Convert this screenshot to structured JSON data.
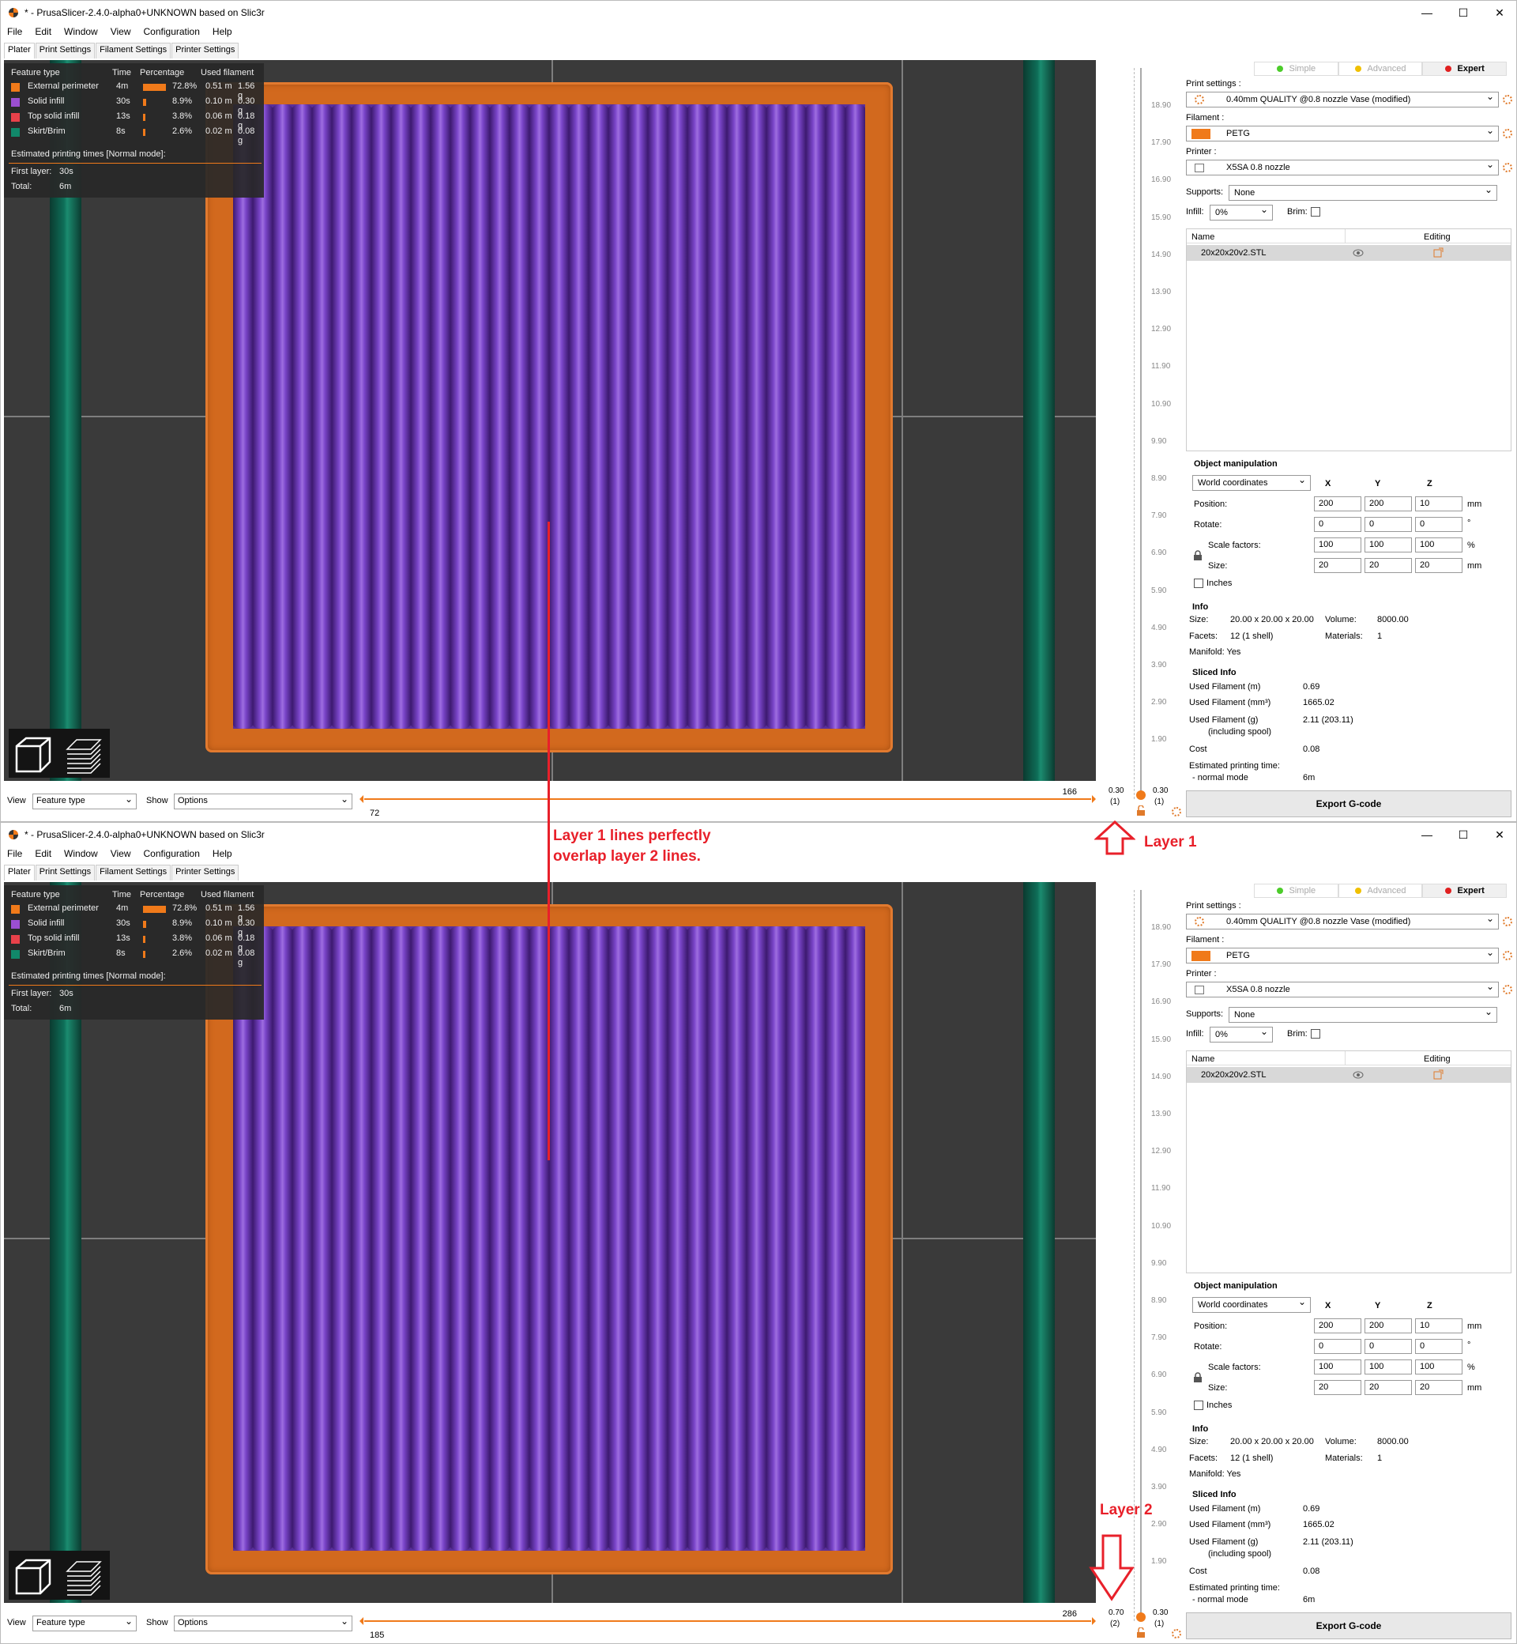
{
  "title": "* - PrusaSlicer-2.4.0-alpha0+UNKNOWN based on Slic3r",
  "window_controls": {
    "minimize": "—",
    "maximize": "☐",
    "close": "✕"
  },
  "menu": [
    "File",
    "Edit",
    "Window",
    "View",
    "Configuration",
    "Help"
  ],
  "tabs": [
    "Plater",
    "Print Settings",
    "Filament Settings",
    "Printer Settings"
  ],
  "legend": {
    "headers": {
      "feature": "Feature type",
      "time": "Time",
      "pct": "Percentage",
      "used": "Used filament"
    },
    "rows": [
      {
        "name": "External perimeter",
        "time": "4m",
        "pct": "72.8%",
        "m": "0.51 m",
        "g": "1.56 g",
        "color": "#f07a1a",
        "frac": 0.728
      },
      {
        "name": "Solid infill",
        "time": "30s",
        "pct": "8.9%",
        "m": "0.10 m",
        "g": "0.30 g",
        "color": "#9b4fd1",
        "frac": 0.089
      },
      {
        "name": "Top solid infill",
        "time": "13s",
        "pct": "3.8%",
        "m": "0.06 m",
        "g": "0.18 g",
        "color": "#e8414a",
        "frac": 0.038
      },
      {
        "name": "Skirt/Brim",
        "time": "8s",
        "pct": "2.6%",
        "m": "0.02 m",
        "g": "0.08 g",
        "color": "#11886a",
        "frac": 0.026
      }
    ],
    "est_title": "Estimated printing times [Normal mode]:",
    "first_layer_label": "First layer:",
    "first_layer": "30s",
    "total_label": "Total:",
    "total": "6m"
  },
  "bottom": {
    "view_label": "View",
    "view_value": "Feature type",
    "show_label": "Show",
    "show_value": "Options"
  },
  "vticks": [
    "18.90",
    "17.90",
    "16.90",
    "15.90",
    "14.90",
    "13.90",
    "12.90",
    "11.90",
    "10.90",
    "9.90",
    "8.90",
    "7.90",
    "6.90",
    "5.90",
    "4.90",
    "3.90",
    "2.90",
    "1.90"
  ],
  "panel": {
    "modes": [
      "Simple",
      "Advanced",
      "Expert"
    ],
    "mode_colors": [
      "#4ccc2a",
      "#f0c000",
      "#e02020"
    ],
    "print_label": "Print settings :",
    "print_value": "0.40mm QUALITY @0.8 nozzle Vase (modified)",
    "filament_label": "Filament :",
    "filament_value": "PETG",
    "filament_color": "#f07a1a",
    "printer_label": "Printer :",
    "printer_value": "X5SA 0.8 nozzle",
    "supports_label": "Supports:",
    "supports_value": "None",
    "infill_label": "Infill:",
    "infill_value": "0%",
    "brim_label": "Brim:",
    "list_name": "Name",
    "list_editing": "Editing",
    "object_name": "20x20x20v2.STL",
    "om_title": "Object manipulation",
    "coords": "World coordinates",
    "x": "X",
    "y": "Y",
    "z": "Z",
    "position_label": "Position:",
    "position": [
      "200",
      "200",
      "10"
    ],
    "mm": "mm",
    "rotate_label": "Rotate:",
    "rotate": [
      "0",
      "0",
      "0"
    ],
    "deg": "°",
    "scale_label": "Scale factors:",
    "scale": [
      "100",
      "100",
      "100"
    ],
    "pct": "%",
    "size_label": "Size:",
    "size": [
      "20",
      "20",
      "20"
    ],
    "inches": "Inches",
    "info_title": "Info",
    "info_size_label": "Size:",
    "info_size": "20.00 x 20.00 x 20.00",
    "volume_label": "Volume:",
    "volume": "8000.00",
    "facets_label": "Facets:",
    "facets": "12 (1 shell)",
    "materials_label": "Materials:",
    "materials": "1",
    "manifold": "Manifold: Yes",
    "sliced_title": "Sliced Info",
    "used_m_label": "Used Filament (m)",
    "used_m": "0.69",
    "used_mm3_label": "Used Filament (mm³)",
    "used_mm3": "1665.02",
    "used_g_label": "Used Filament (g)",
    "used_g_sub": "(including spool)",
    "used_g": "2.11 (203.11)",
    "cost_label": "Cost",
    "cost": "0.08",
    "est_label": "Estimated printing time:",
    "normal_label": "- normal mode",
    "normal": "6m",
    "export": "Export G-code"
  },
  "windows": [
    {
      "hslider_right": "166",
      "hslider_left": "72",
      "vbottom": "0.30",
      "vbottom_idx": "(1)",
      "vtop": "0.30",
      "vtop_idx": "(1)"
    },
    {
      "hslider_right": "286",
      "hslider_left": "185",
      "vbottom": "0.70",
      "vbottom_idx": "(2)",
      "vtop": "0.30",
      "vtop_idx": "(1)"
    }
  ],
  "annotations": {
    "overlap_line1": "Layer 1 lines perfectly",
    "overlap_line2": "overlap layer 2 lines.",
    "layer1": "Layer 1",
    "layer2": "Layer 2"
  }
}
